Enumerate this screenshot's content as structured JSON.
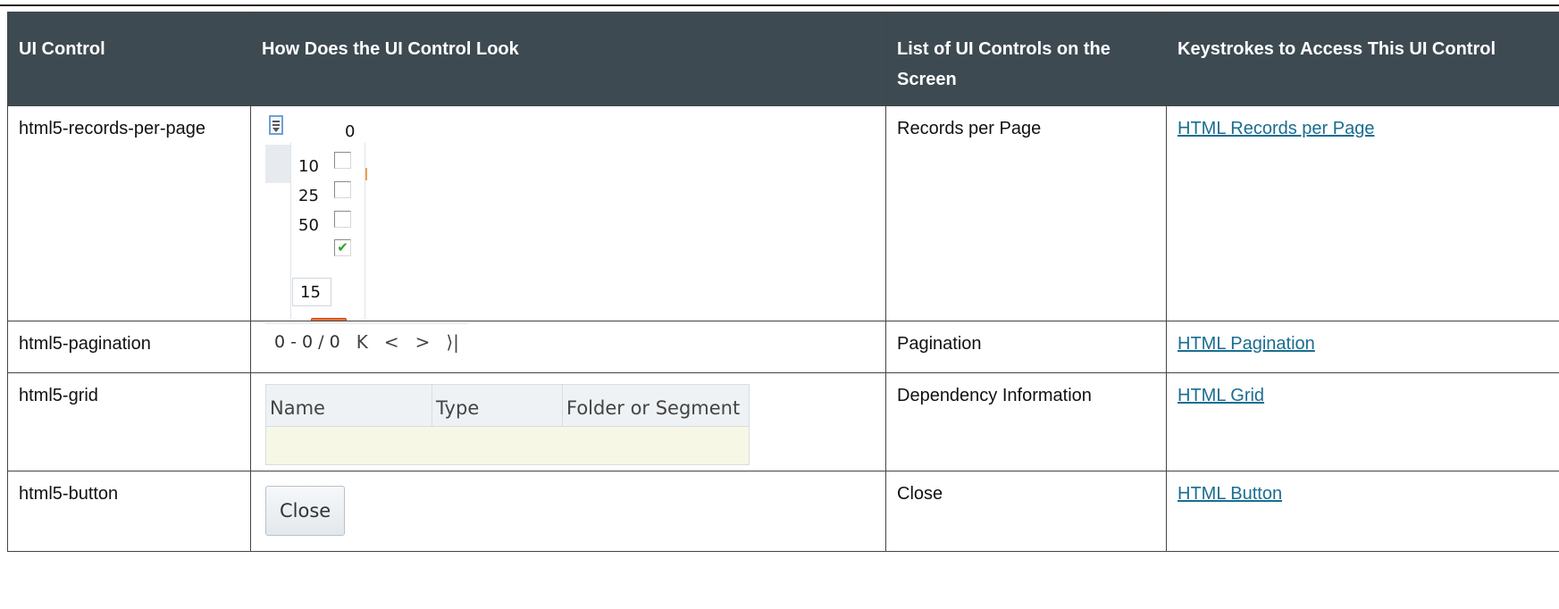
{
  "headers": {
    "ui_control": "UI Control",
    "how_look": "How Does the UI Control Look",
    "list_controls": "List of UI Controls on the Screen",
    "keystrokes": "Keystrokes to Access This UI Control"
  },
  "rows": [
    {
      "control": "html5-records-per-page",
      "list": "Records per Page",
      "link": "HTML Records per Page",
      "widget": {
        "count": "0",
        "options": [
          "10",
          "25",
          "50"
        ],
        "input_value": "15",
        "go_icon": "arrow-right-icon",
        "checked": "✔"
      }
    },
    {
      "control": "html5-pagination",
      "list": "Pagination",
      "link": "HTML Pagination",
      "widget": {
        "range": "0 - 0 / 0",
        "first": "K",
        "prev": "<",
        "next": ">",
        "last": "⟩|"
      }
    },
    {
      "control": "html5-grid",
      "list": "Dependency Information",
      "link": "HTML Grid",
      "widget": {
        "columns": [
          "Name",
          "Type",
          "Folder or Segment"
        ]
      }
    },
    {
      "control": "html5-button",
      "list": "Close",
      "link": "HTML Button",
      "widget": {
        "label": "Close"
      }
    }
  ]
}
